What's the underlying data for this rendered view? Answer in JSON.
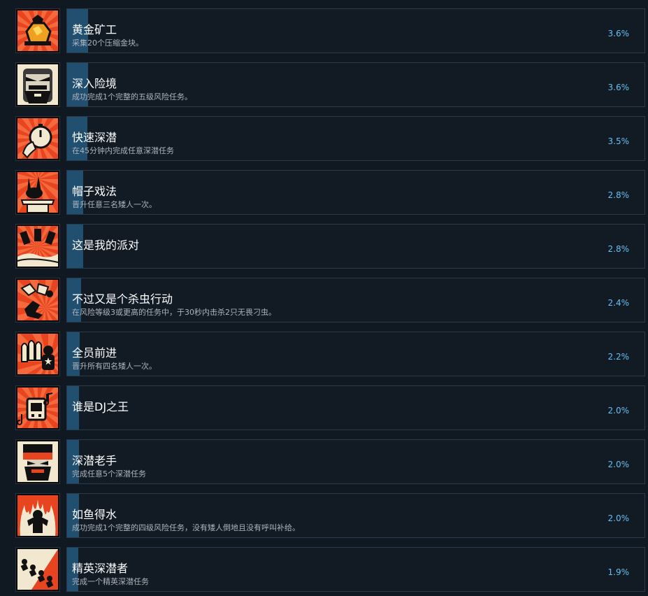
{
  "achievements": [
    {
      "title": "黄金矿工",
      "description": "采集20个压缩金块。",
      "percent": "3.6%",
      "icon": "gold-nugget-icon"
    },
    {
      "title": "深入险境",
      "description": "成功完成1个完整的五级风险任务。",
      "percent": "3.6%",
      "icon": "angry-dwarf-icon"
    },
    {
      "title": "快速深潜",
      "description": "在45分钟内完成任意深潜任务",
      "percent": "3.5%",
      "icon": "stopwatch-icon"
    },
    {
      "title": "帽子戏法",
      "description": "晋升任意三名矮人一次。",
      "percent": "2.8%",
      "icon": "rabbit-hat-icon"
    },
    {
      "title": "这是我的派对",
      "description": "",
      "percent": "2.8%",
      "icon": "party-cannons-icon"
    },
    {
      "title": "不过又是个杀虫行动",
      "description": "在风险等级3或更高的任务中，于30秒内击杀2只无畏刁虫。",
      "percent": "2.4%",
      "icon": "bug-kill-icon"
    },
    {
      "title": "全员前进",
      "description": "晋升所有四名矮人一次。",
      "percent": "2.2%",
      "icon": "four-dwarves-icon"
    },
    {
      "title": "谁是DJ之王",
      "description": "",
      "percent": "2.0%",
      "icon": "jukebox-icon"
    },
    {
      "title": "深潜老手",
      "description": "完成任意5个深潜任务",
      "percent": "2.0%",
      "icon": "veteran-dwarf-icon"
    },
    {
      "title": "如鱼得水",
      "description": "成功完成1个完整的四级风险任务，没有矮人倒地且没有呼叫补给。",
      "percent": "2.0%",
      "icon": "dwarf-fire-icon"
    },
    {
      "title": "精英深潜者",
      "description": "完成一个精英深潜任务",
      "percent": "1.9%",
      "icon": "running-dwarves-icon"
    }
  ],
  "colors": {
    "background": "#101822",
    "panel": "#121a24",
    "panel_border": "#2b3b4c",
    "progress_fill": "#214f70",
    "title_text": "#ffffff",
    "description_text": "#aeb4bb",
    "percent_text": "#66c0f4",
    "icon_red": "#e84420",
    "icon_cream": "#f2e8cf"
  }
}
